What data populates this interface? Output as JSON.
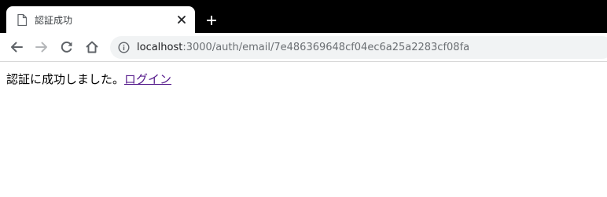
{
  "browser": {
    "tab": {
      "title": "認証成功",
      "favicon": "document-icon",
      "close": "close-icon"
    },
    "new_tab": "plus-icon",
    "toolbar": {
      "back": "arrow-left-icon",
      "forward": "arrow-right-icon",
      "reload": "reload-icon",
      "home": "home-icon"
    },
    "address_bar": {
      "icon": "info-icon",
      "host": "localhost",
      "rest": ":3000/auth/email/7e486369648cf04ec6a25a2283cf08fa"
    }
  },
  "page": {
    "message": "認証に成功しました。",
    "link_text": "ログイン"
  },
  "colors": {
    "tabstrip": "#000000",
    "omnibox": "#f1f3f4",
    "link_visited": "#551a8b"
  }
}
